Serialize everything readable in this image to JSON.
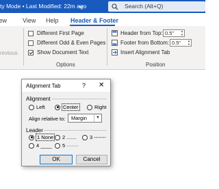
{
  "titlebar": {
    "title": "ty Mode • Last Modified: 22m ago",
    "search_placeholder": "Search (Alt+Q)",
    "bg_color": "#185abd"
  },
  "tabs": [
    {
      "label": "view"
    },
    {
      "label": "View"
    },
    {
      "label": "Help"
    },
    {
      "label": "Header & Footer",
      "active": true
    }
  ],
  "ribbon": {
    "previous_label": "revious",
    "options": {
      "items": [
        {
          "label": "Different First Page",
          "checked": false
        },
        {
          "label": "Different Odd & Even Pages",
          "checked": false
        },
        {
          "label": "Show Document Text",
          "checked": true
        }
      ],
      "group_label": "Options"
    },
    "position": {
      "header_label": "Header from Top:",
      "header_value": "0.5\"",
      "footer_label": "Footer from Bottom:",
      "footer_value": "0.5\"",
      "insert_label": "Insert Alignment Tab",
      "group_label": "Position"
    }
  },
  "dialog": {
    "title": "Alignment Tab",
    "help": "?",
    "close": "✕",
    "alignment": {
      "label": "Alignment",
      "options": [
        "Left",
        "Center",
        "Right"
      ],
      "selected": "Center"
    },
    "align_relative": {
      "label": "Align relative to:",
      "value": "Margin"
    },
    "leader": {
      "label": "Leader",
      "options": [
        "1 None",
        "2 .......",
        "3 -------",
        "4 ____",
        "5 ·······"
      ],
      "selected": "1 None"
    },
    "ok_label": "OK",
    "cancel_label": "Cancel"
  }
}
